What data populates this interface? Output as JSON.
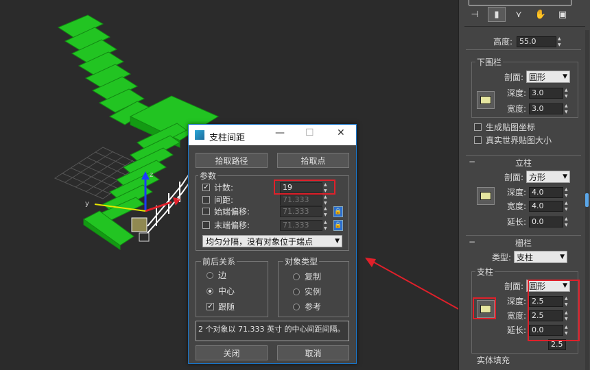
{
  "command_panel": {
    "tabs": [
      "pin-icon",
      "modifier-icon",
      "hierarchy-icon",
      "hand-icon",
      "display-icon"
    ],
    "height_label": "高度:",
    "height_value": "55.0",
    "lower_rail": {
      "title": "下围栏",
      "profile_label": "剖面:",
      "profile_value": "圆形",
      "depth_label": "深度:",
      "depth_value": "3.0",
      "width_label": "宽度:",
      "width_value": "3.0"
    },
    "gen_mapping": "生成贴图坐标",
    "real_world": "真实世界贴图大小",
    "posts": {
      "title": "立柱",
      "profile_label": "剖面:",
      "profile_value": "方形",
      "depth_label": "深度:",
      "depth_value": "4.0",
      "width_label": "宽度:",
      "width_value": "4.0",
      "extension_label": "延长:",
      "extension_value": "0.0"
    },
    "fencing": {
      "title": "栅栏",
      "type_label": "类型:",
      "type_value": "支柱",
      "support_title": "支柱",
      "profile_label": "剖面:",
      "profile_value": "圆形",
      "depth_label": "深度:",
      "depth_value": "2.5",
      "width_label": "宽度:",
      "width_value": "2.5",
      "extension_label": "延长:",
      "extension_value": "0.0",
      "extra_value": "2.5",
      "solid_fill": "实体填充"
    }
  },
  "dialog": {
    "title": "支柱间距",
    "pick_path": "拾取路径",
    "pick_points": "拾取点",
    "params_title": "参数",
    "count_label": "计数:",
    "count_value": "19",
    "spacing_label": "间距:",
    "spacing_value": "71.333",
    "start_offset_label": "始端偏移:",
    "start_offset_value": "71.333",
    "end_offset_label": "末端偏移:",
    "end_offset_value": "71.333",
    "distribution": "均匀分隔，没有对象位于端点",
    "context_title": "前后关系",
    "edges": "边",
    "centers": "中心",
    "follow": "跟随",
    "object_type_title": "对象类型",
    "copy": "复制",
    "instance": "实例",
    "reference": "参考",
    "status": "2 个对象以 71.333 英寸 的中心间距间隔。",
    "close": "关闭",
    "cancel": "取消"
  },
  "viewport": {
    "axis_x": "x",
    "axis_y": "y",
    "axis_z": "z"
  },
  "colors": {
    "stairs": "#1fbf1f",
    "highlight": "#e0202a",
    "dialog_border": "#1a75c8"
  }
}
